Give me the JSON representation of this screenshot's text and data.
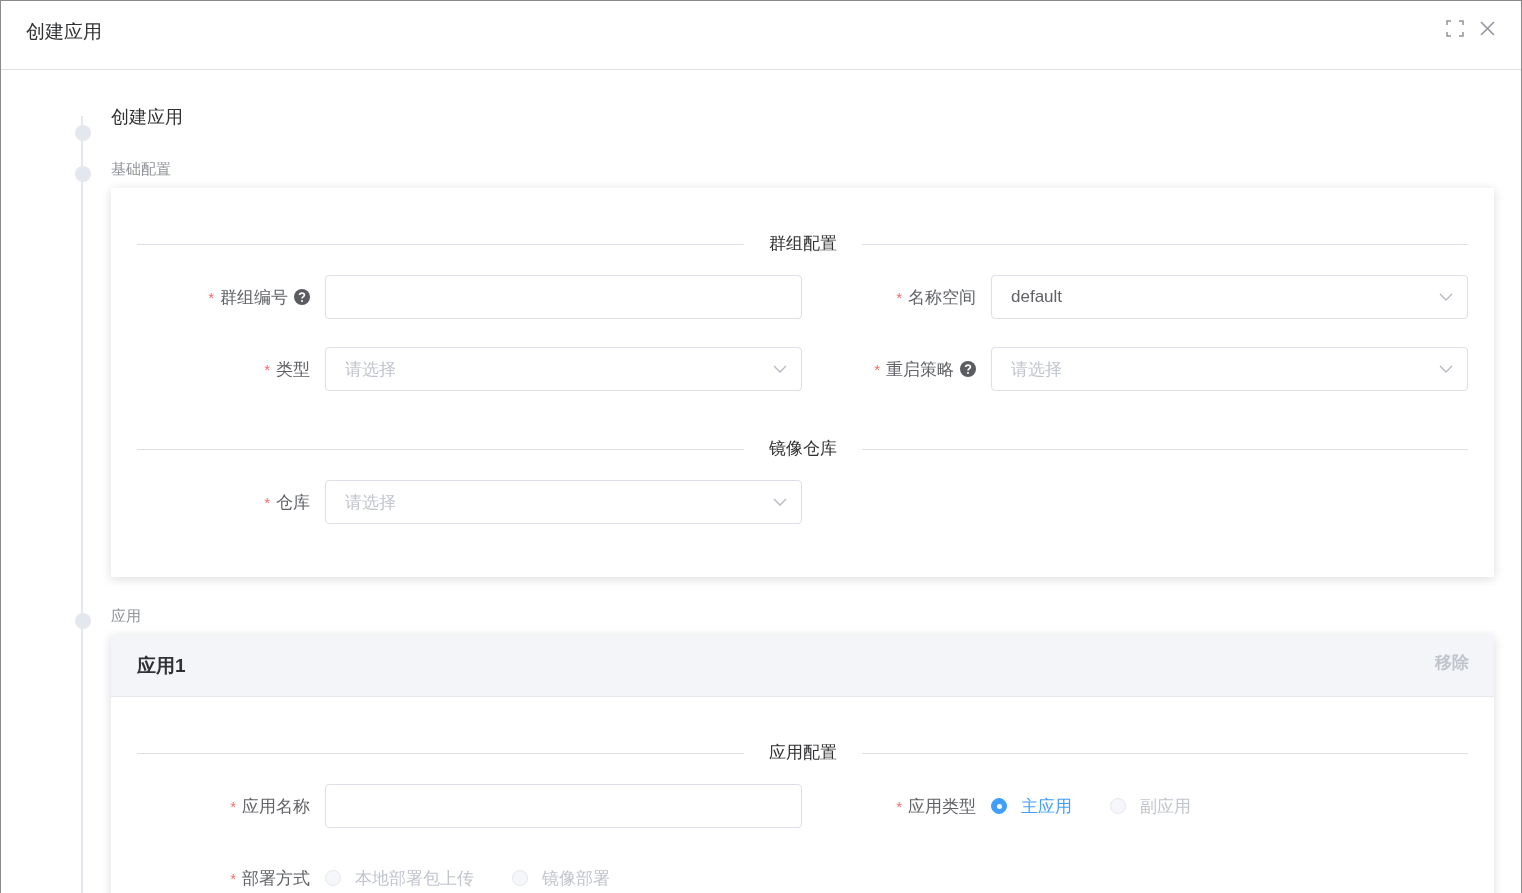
{
  "dialog": {
    "title": "创建应用"
  },
  "steps": [
    {
      "label": "创建应用",
      "kind": "title"
    },
    {
      "label": "基础配置",
      "kind": "section",
      "panel": {
        "groups": [
          {
            "heading": "群组配置",
            "fields": [
              {
                "label": "群组编号",
                "required": "*",
                "help": true,
                "kind": "input"
              },
              {
                "label": "名称空间",
                "required": "*",
                "help": false,
                "kind": "select",
                "value": "default"
              },
              {
                "label": "类型",
                "required": "*",
                "help": false,
                "kind": "select",
                "placeholder": "请选择"
              },
              {
                "label": "重启策略",
                "required": "*",
                "help": true,
                "kind": "select",
                "placeholder": "请选择"
              }
            ]
          },
          {
            "heading": "镜像仓库",
            "fields": [
              {
                "label": "仓库",
                "required": "*",
                "help": false,
                "kind": "select",
                "placeholder": "请选择"
              }
            ]
          }
        ]
      }
    },
    {
      "label": "应用",
      "kind": "section",
      "panel": {
        "header": {
          "title": "应用1",
          "action": "移除"
        },
        "groups": [
          {
            "heading": "应用配置",
            "fields": [
              {
                "label": "应用名称",
                "required": "*",
                "help": false,
                "kind": "input"
              },
              {
                "label": "应用类型",
                "required": "*",
                "help": false,
                "kind": "radio",
                "options": [
                  {
                    "label": "主应用",
                    "selected": true,
                    "disabled": false
                  },
                  {
                    "label": "副应用",
                    "selected": false,
                    "disabled": true
                  }
                ]
              },
              {
                "label": "部署方式",
                "required": "*",
                "help": false,
                "kind": "radio",
                "options": [
                  {
                    "label": "本地部署包上传",
                    "selected": false,
                    "disabled": true
                  },
                  {
                    "label": "镜像部署",
                    "selected": false,
                    "disabled": true
                  }
                ]
              }
            ]
          }
        ]
      }
    }
  ]
}
